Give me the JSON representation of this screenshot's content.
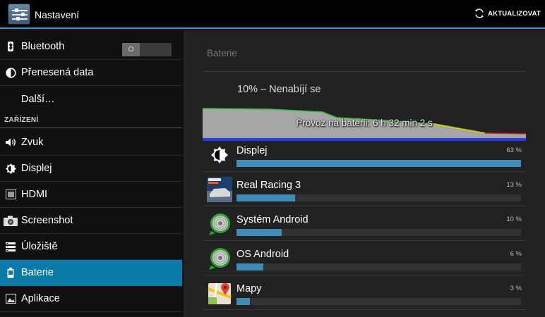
{
  "actionbar": {
    "title": "Nastavení",
    "refresh_label": "AKTUALIZOVAT"
  },
  "sidebar": {
    "items": [
      {
        "label": "Bluetooth",
        "icon": "bluetooth-icon"
      },
      {
        "label": "Přenesená data",
        "icon": "data-usage-icon"
      },
      {
        "label": "Další…",
        "icon": ""
      }
    ],
    "section_label": "ZAŘÍZENÍ",
    "device_items": [
      {
        "label": "Zvuk",
        "icon": "speaker-icon"
      },
      {
        "label": "Displej",
        "icon": "brightness-icon"
      },
      {
        "label": "HDMI",
        "icon": "hdmi-icon"
      },
      {
        "label": "Screenshot",
        "icon": "camera-icon"
      },
      {
        "label": "Úložiště",
        "icon": "storage-icon"
      },
      {
        "label": "Baterie",
        "icon": "battery-icon",
        "active": true
      },
      {
        "label": "Aplikace",
        "icon": "apps-icon"
      }
    ],
    "bluetooth_toggle": "O"
  },
  "battery": {
    "panel_title": "Baterie",
    "status": "10% – Nenabíjí se",
    "graph_label": "Provoz na baterii: 6 h 32 min 2 s",
    "apps": [
      {
        "name": "Displej",
        "percent_label": "63 %",
        "percent": 63,
        "icon": "display-brightness-icon"
      },
      {
        "name": "Real Racing 3",
        "percent_label": "13 %",
        "percent": 13,
        "icon": "real-racing-icon"
      },
      {
        "name": "Systém Android",
        "percent_label": "10 %",
        "percent": 10,
        "icon": "android-system-icon"
      },
      {
        "name": "OS Android",
        "percent_label": "6 %",
        "percent": 6,
        "icon": "android-os-icon"
      },
      {
        "name": "Mapy",
        "percent_label": "3 %",
        "percent": 3,
        "icon": "maps-icon"
      }
    ]
  },
  "colors": {
    "accent": "#2d9fd0",
    "selected": "#0a7aa9",
    "bar": "#3f8cb8"
  }
}
